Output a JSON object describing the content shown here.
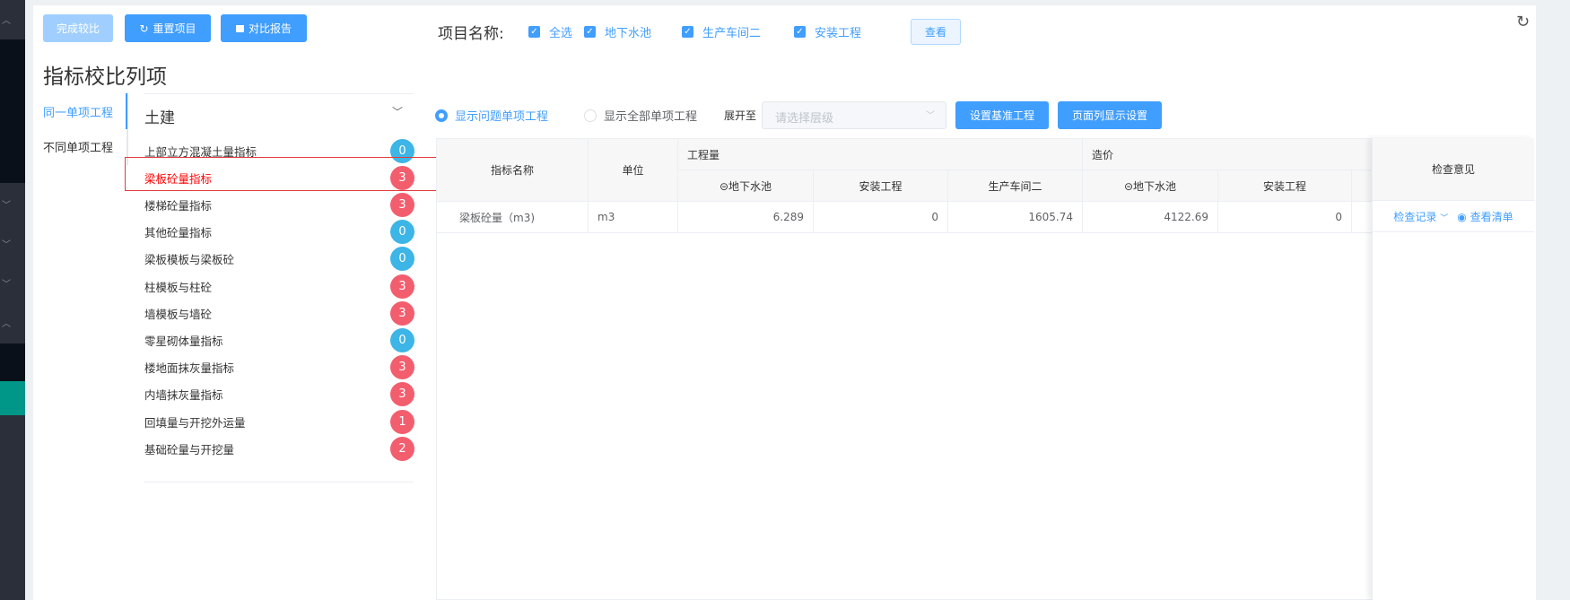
{
  "toolbar": {
    "finish": "完成较比",
    "reset": "重置项目",
    "report": "对比报告"
  },
  "project_filter": {
    "label": "项目名称:",
    "options": [
      {
        "label": "全选",
        "checked": true
      },
      {
        "label": "地下水池",
        "checked": true
      },
      {
        "label": "生产车间二",
        "checked": true
      },
      {
        "label": "安装工程",
        "checked": true
      }
    ],
    "view": "查看"
  },
  "title": "指标校比列项",
  "vtabs": [
    {
      "label": "同一单项工程",
      "active": true
    },
    {
      "label": "不同单项工程",
      "active": false
    }
  ],
  "category": {
    "label": "土建",
    "items": [
      {
        "label": "上部立方混凝土量指标",
        "count": "0",
        "status": "ok"
      },
      {
        "label": "梁板砼量指标",
        "count": "3",
        "status": "issue",
        "selected": true
      },
      {
        "label": "楼梯砼量指标",
        "count": "3",
        "status": "issue"
      },
      {
        "label": "其他砼量指标",
        "count": "0",
        "status": "ok"
      },
      {
        "label": "梁板模板与梁板砼",
        "count": "0",
        "status": "ok"
      },
      {
        "label": "柱模板与柱砼",
        "count": "3",
        "status": "issue"
      },
      {
        "label": "墙模板与墙砼",
        "count": "3",
        "status": "issue"
      },
      {
        "label": "零星砌体量指标",
        "count": "0",
        "status": "ok"
      },
      {
        "label": "楼地面抹灰量指标",
        "count": "3",
        "status": "issue"
      },
      {
        "label": "内墙抹灰量指标",
        "count": "3",
        "status": "issue"
      },
      {
        "label": "回填量与开挖外运量",
        "count": "1",
        "status": "issue"
      },
      {
        "label": "基础砼量与开挖量",
        "count": "2",
        "status": "issue"
      }
    ]
  },
  "colors": {
    "ok": "#3db5e6",
    "issue": "#f25e6e",
    "accent": "#409eff"
  },
  "options": {
    "show_problem": "显示问题单项工程",
    "show_all": "显示全部单项工程",
    "expand_label": "展开至",
    "level_placeholder": "请选择层级",
    "set_base": "设置基准工程",
    "column_settings": "页面列显示设置"
  },
  "table": {
    "headers": {
      "name": "指标名称",
      "unit": "单位",
      "quantity": "工程量",
      "cost": "造价",
      "q_cols": [
        "⊝地下水池",
        "安装工程",
        "生产车间二"
      ],
      "c_cols": [
        "⊝地下水池",
        "安装工程"
      ],
      "review": "检查意见"
    },
    "rows": [
      {
        "name": "梁板砼量（m3)",
        "unit": "m3",
        "q": [
          "6.289",
          "0",
          "1605.74"
        ],
        "c": [
          "4122.69",
          "0"
        ],
        "record": "检查记录",
        "view_list": "查看清单"
      }
    ]
  }
}
